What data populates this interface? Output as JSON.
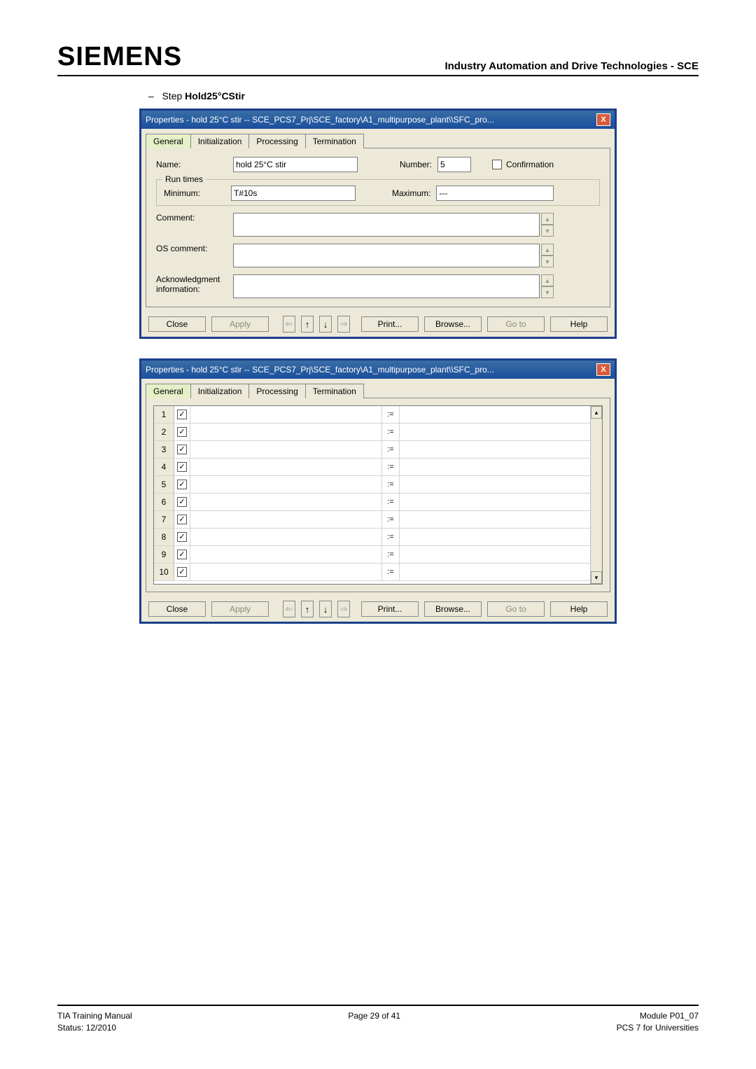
{
  "header": {
    "logo": "SIEMENS",
    "right": "Industry Automation and Drive Technologies - SCE"
  },
  "step": {
    "dash": "–",
    "prefix": "Step",
    "name": "Hold25°CStir"
  },
  "dlg1": {
    "title": "Properties -  hold 25°C stir -- SCE_PCS7_Prj\\SCE_factory\\A1_multipurpose_plant\\\\SFC_pro...",
    "tabs": {
      "general": "General",
      "init": "Initialization",
      "proc": "Processing",
      "term": "Termination"
    },
    "name_label": "Name:",
    "name_value": "hold 25°C stir",
    "number_label": "Number:",
    "number_value": "5",
    "confirm_label": "Confirmation",
    "runtimes_legend": "Run times",
    "min_label": "Minimum:",
    "min_value": "T#10s",
    "max_label": "Maximum:",
    "max_value": "---",
    "comment_label": "Comment:",
    "comment_value": "",
    "oscomment_label": "OS comment:",
    "oscomment_value": "",
    "ack_label": "Acknowledgment information:",
    "ack_value": "",
    "buttons": {
      "close": "Close",
      "apply": "Apply",
      "print": "Print...",
      "browse": "Browse...",
      "goto": "Go to",
      "help": "Help"
    }
  },
  "dlg2": {
    "title": "Properties -  hold 25°C stir -- SCE_PCS7_Prj\\SCE_factory\\A1_multipurpose_plant\\\\SFC_pro...",
    "tabs": {
      "general": "General",
      "init": "Initialization",
      "proc": "Processing",
      "term": "Termination"
    },
    "rows": [
      1,
      2,
      3,
      4,
      5,
      6,
      7,
      8,
      9,
      10
    ],
    "assign": ":=",
    "buttons": {
      "close": "Close",
      "apply": "Apply",
      "print": "Print...",
      "browse": "Browse...",
      "goto": "Go to",
      "help": "Help"
    }
  },
  "footer": {
    "left1": "TIA Training Manual",
    "left2": "Status: 12/2010",
    "center": "Page 29 of 41",
    "right1": "Module P01_07",
    "right2": "PCS 7 for Universities"
  }
}
